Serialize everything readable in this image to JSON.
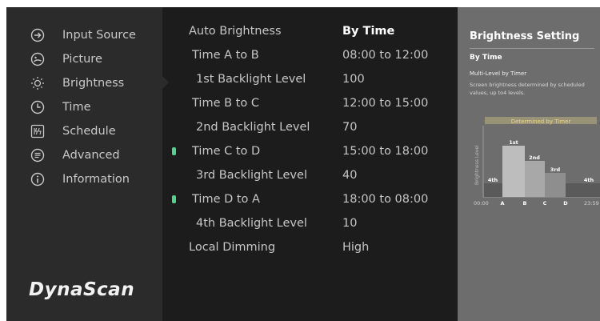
{
  "sidebar": {
    "items": [
      {
        "label": "Input Source",
        "icon": "input-source-icon"
      },
      {
        "label": "Picture",
        "icon": "picture-icon"
      },
      {
        "label": "Brightness",
        "icon": "brightness-icon"
      },
      {
        "label": "Time",
        "icon": "clock-icon"
      },
      {
        "label": "Schedule",
        "icon": "schedule-icon"
      },
      {
        "label": "Advanced",
        "icon": "advanced-icon"
      },
      {
        "label": "Information",
        "icon": "info-icon"
      }
    ],
    "selected": "Brightness",
    "logo": "DynaScan"
  },
  "settings": [
    {
      "label": "Auto Brightness",
      "value": "By Time"
    },
    {
      "label": "Time A to B",
      "value": "08:00 to 12:00"
    },
    {
      "label": "1st Backlight Level",
      "value": "100"
    },
    {
      "label": "Time B to C",
      "value": "12:00 to 15:00"
    },
    {
      "label": "2nd Backlight Level",
      "value": "70"
    },
    {
      "label": "Time C to D",
      "value": "15:00 to 18:00"
    },
    {
      "label": "3rd Backlight Level",
      "value": "40"
    },
    {
      "label": "Time D to A",
      "value": "18:00 to 08:00"
    },
    {
      "label": "4th Backlight Level",
      "value": "10"
    },
    {
      "label": "Local Dimming",
      "value": "High"
    }
  ],
  "info_panel": {
    "title": "Brightness Setting",
    "subtitle": "By Time",
    "desc_title": "Multi-Level by Timer",
    "desc": "Screen brightness determined by scheduled values, up to4 levels.",
    "chart": {
      "banner": "Determined by Timer",
      "ylabel": "Brightness Level",
      "start": "00:00",
      "end": "23:59",
      "markers": [
        "A",
        "B",
        "C",
        "D"
      ],
      "levels": [
        "4th",
        "1st",
        "2nd",
        "3rd",
        "4th"
      ]
    }
  },
  "colors": {
    "sidebar_bg": "#2b2b2b",
    "main_bg": "#1c1c1c",
    "info_bg": "#6d6d6d",
    "indicator": "#4fd38f",
    "banner": "#e8d68a"
  }
}
